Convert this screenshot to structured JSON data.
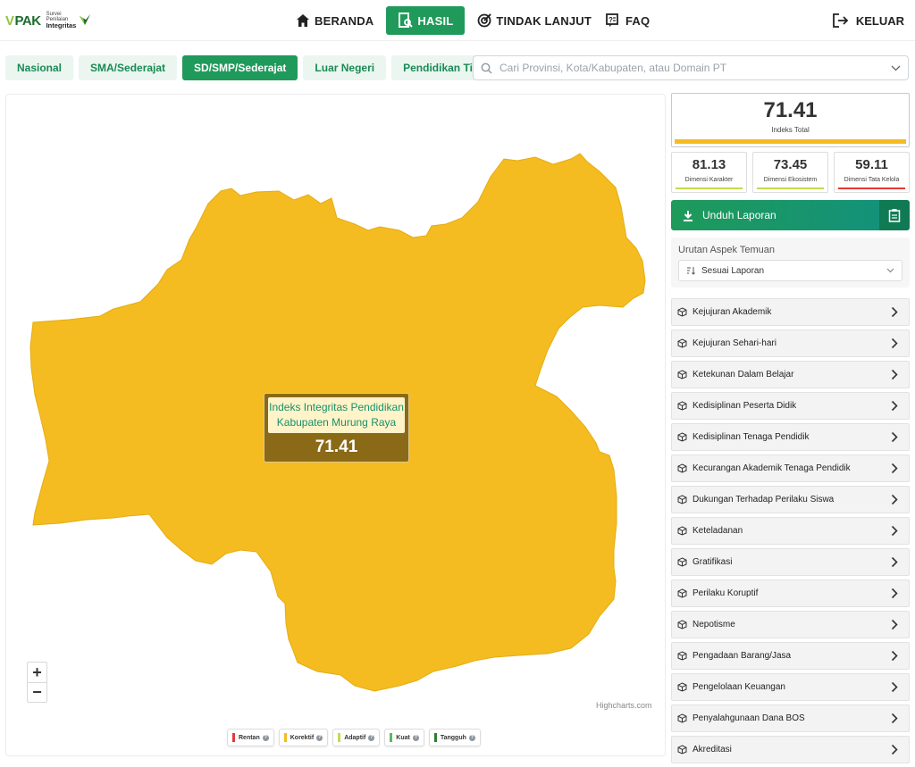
{
  "header": {
    "logo_text": "PAK",
    "logo_sub1": "Survei",
    "logo_sub2": "Penilaian",
    "logo_sub3": "Integritas",
    "nav": [
      {
        "label": "BERANDA",
        "icon": "home-icon"
      },
      {
        "label": "HASIL",
        "icon": "report-search-icon",
        "active": true
      },
      {
        "label": "TINDAK LANJUT",
        "icon": "target-icon"
      },
      {
        "label": "FAQ",
        "icon": "faq-icon"
      }
    ],
    "logout_label": "KELUAR"
  },
  "tabs": [
    {
      "label": "Nasional"
    },
    {
      "label": "SMA/Sederajat"
    },
    {
      "label": "SD/SMP/Sederajat",
      "active": true
    },
    {
      "label": "Luar Negeri"
    },
    {
      "label": "Pendidikan Tinggi"
    }
  ],
  "search": {
    "placeholder": "Cari Provinsi, Kota/Kabupaten, atau Domain PT"
  },
  "map": {
    "region_color": "#f4bc21",
    "tooltip_title_line1": "Indeks Integritas Pendidikan",
    "tooltip_title_line2": "Kabupaten Murung Raya",
    "tooltip_value": "71.41",
    "zoom_in": "+",
    "zoom_out": "−",
    "credit": "Highcharts.com",
    "legend": [
      {
        "label": "Rentan",
        "color": "#e53935"
      },
      {
        "label": "Korektif",
        "color": "#f4bc21"
      },
      {
        "label": "Adaptif",
        "color": "#c6d94a"
      },
      {
        "label": "Kuat",
        "color": "#5cb85c"
      },
      {
        "label": "Tangguh",
        "color": "#2e7d32"
      }
    ]
  },
  "summary": {
    "total_value": "71.41",
    "total_label": "Indeks Total",
    "total_color": "#f4bc21",
    "dimensions": [
      {
        "value": "81.13",
        "label": "Dimensi Karakter",
        "color": "#c6d94a"
      },
      {
        "value": "73.45",
        "label": "Dimensi Ekosistem",
        "color": "#c6d94a"
      },
      {
        "value": "59.11",
        "label": "Dimensi Tata Kelola",
        "color": "#e53935"
      }
    ],
    "download_label": "Unduh Laporan"
  },
  "sort": {
    "label": "Urutan Aspek Temuan",
    "selected": "Sesuai Laporan"
  },
  "aspects": [
    "Kejujuran Akademik",
    "Kejujuran Sehari-hari",
    "Ketekunan Dalam Belajar",
    "Kedisiplinan Peserta Didik",
    "Kedisiplinan Tenaga Pendidik",
    "Kecurangan Akademik Tenaga Pendidik",
    "Dukungan Terhadap Perilaku Siswa",
    "Keteladanan",
    "Gratifikasi",
    "Perilaku Koruptif",
    "Nepotisme",
    "Pengadaan Barang/Jasa",
    "Pengelolaan Keuangan",
    "Penyalahgunaan Dana BOS",
    "Akreditasi"
  ]
}
